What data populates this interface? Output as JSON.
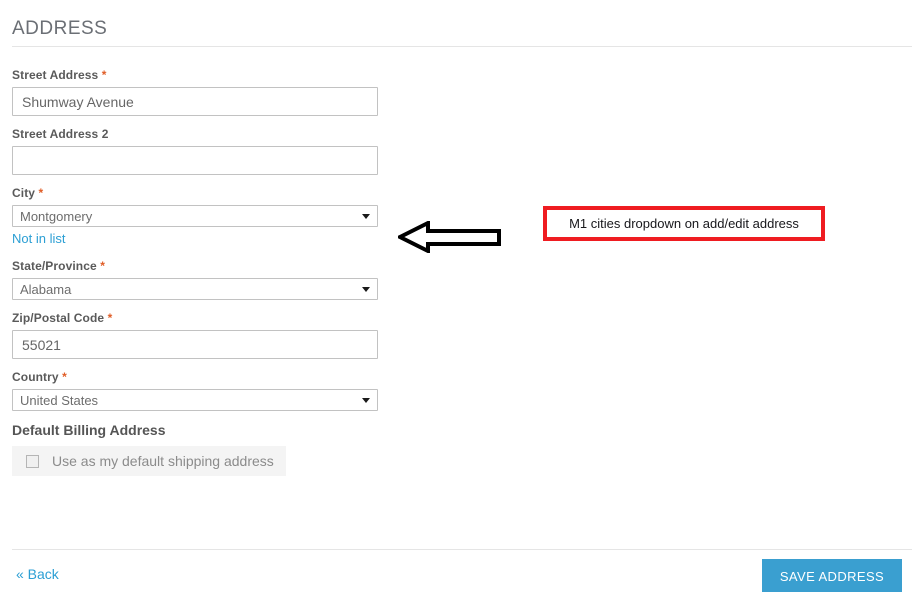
{
  "page": {
    "title": "ADDRESS"
  },
  "form": {
    "fields": [
      {
        "id": "street-address",
        "label": "Street Address",
        "required_marker": "*",
        "control": "text",
        "value": "Shumway Avenue",
        "placeholder": ""
      },
      {
        "id": "street-address-2",
        "label": "Street Address 2",
        "required_marker": "",
        "control": "text",
        "value": "",
        "placeholder": ""
      },
      {
        "id": "city",
        "label": "City",
        "required_marker": "*",
        "control": "select",
        "value": "Montgomery",
        "helper_link": "Not in list"
      },
      {
        "id": "state-province",
        "label": "State/Province",
        "required_marker": "*",
        "control": "select",
        "value": "Alabama"
      },
      {
        "id": "zip-postal-code",
        "label": "Zip/Postal Code",
        "required_marker": "*",
        "control": "text",
        "value": "55021",
        "placeholder": ""
      },
      {
        "id": "country",
        "label": "Country",
        "required_marker": "*",
        "control": "select",
        "value": "United States"
      }
    ],
    "default_billing": {
      "subtitle": "Default Billing Address",
      "checkbox_label": "Use as my default shipping address",
      "checked": false
    }
  },
  "footer": {
    "back_label": "« Back",
    "save_label": "SAVE ADDRESS"
  },
  "annotation": {
    "text": "M1 cities dropdown on add/edit address",
    "border_color": "#ef1c21",
    "arrow_direction": "left"
  },
  "colors": {
    "link": "#2c9fd4",
    "button": "#3a9fd0",
    "required": "#e05d27",
    "annotation": "#ef1c21"
  }
}
